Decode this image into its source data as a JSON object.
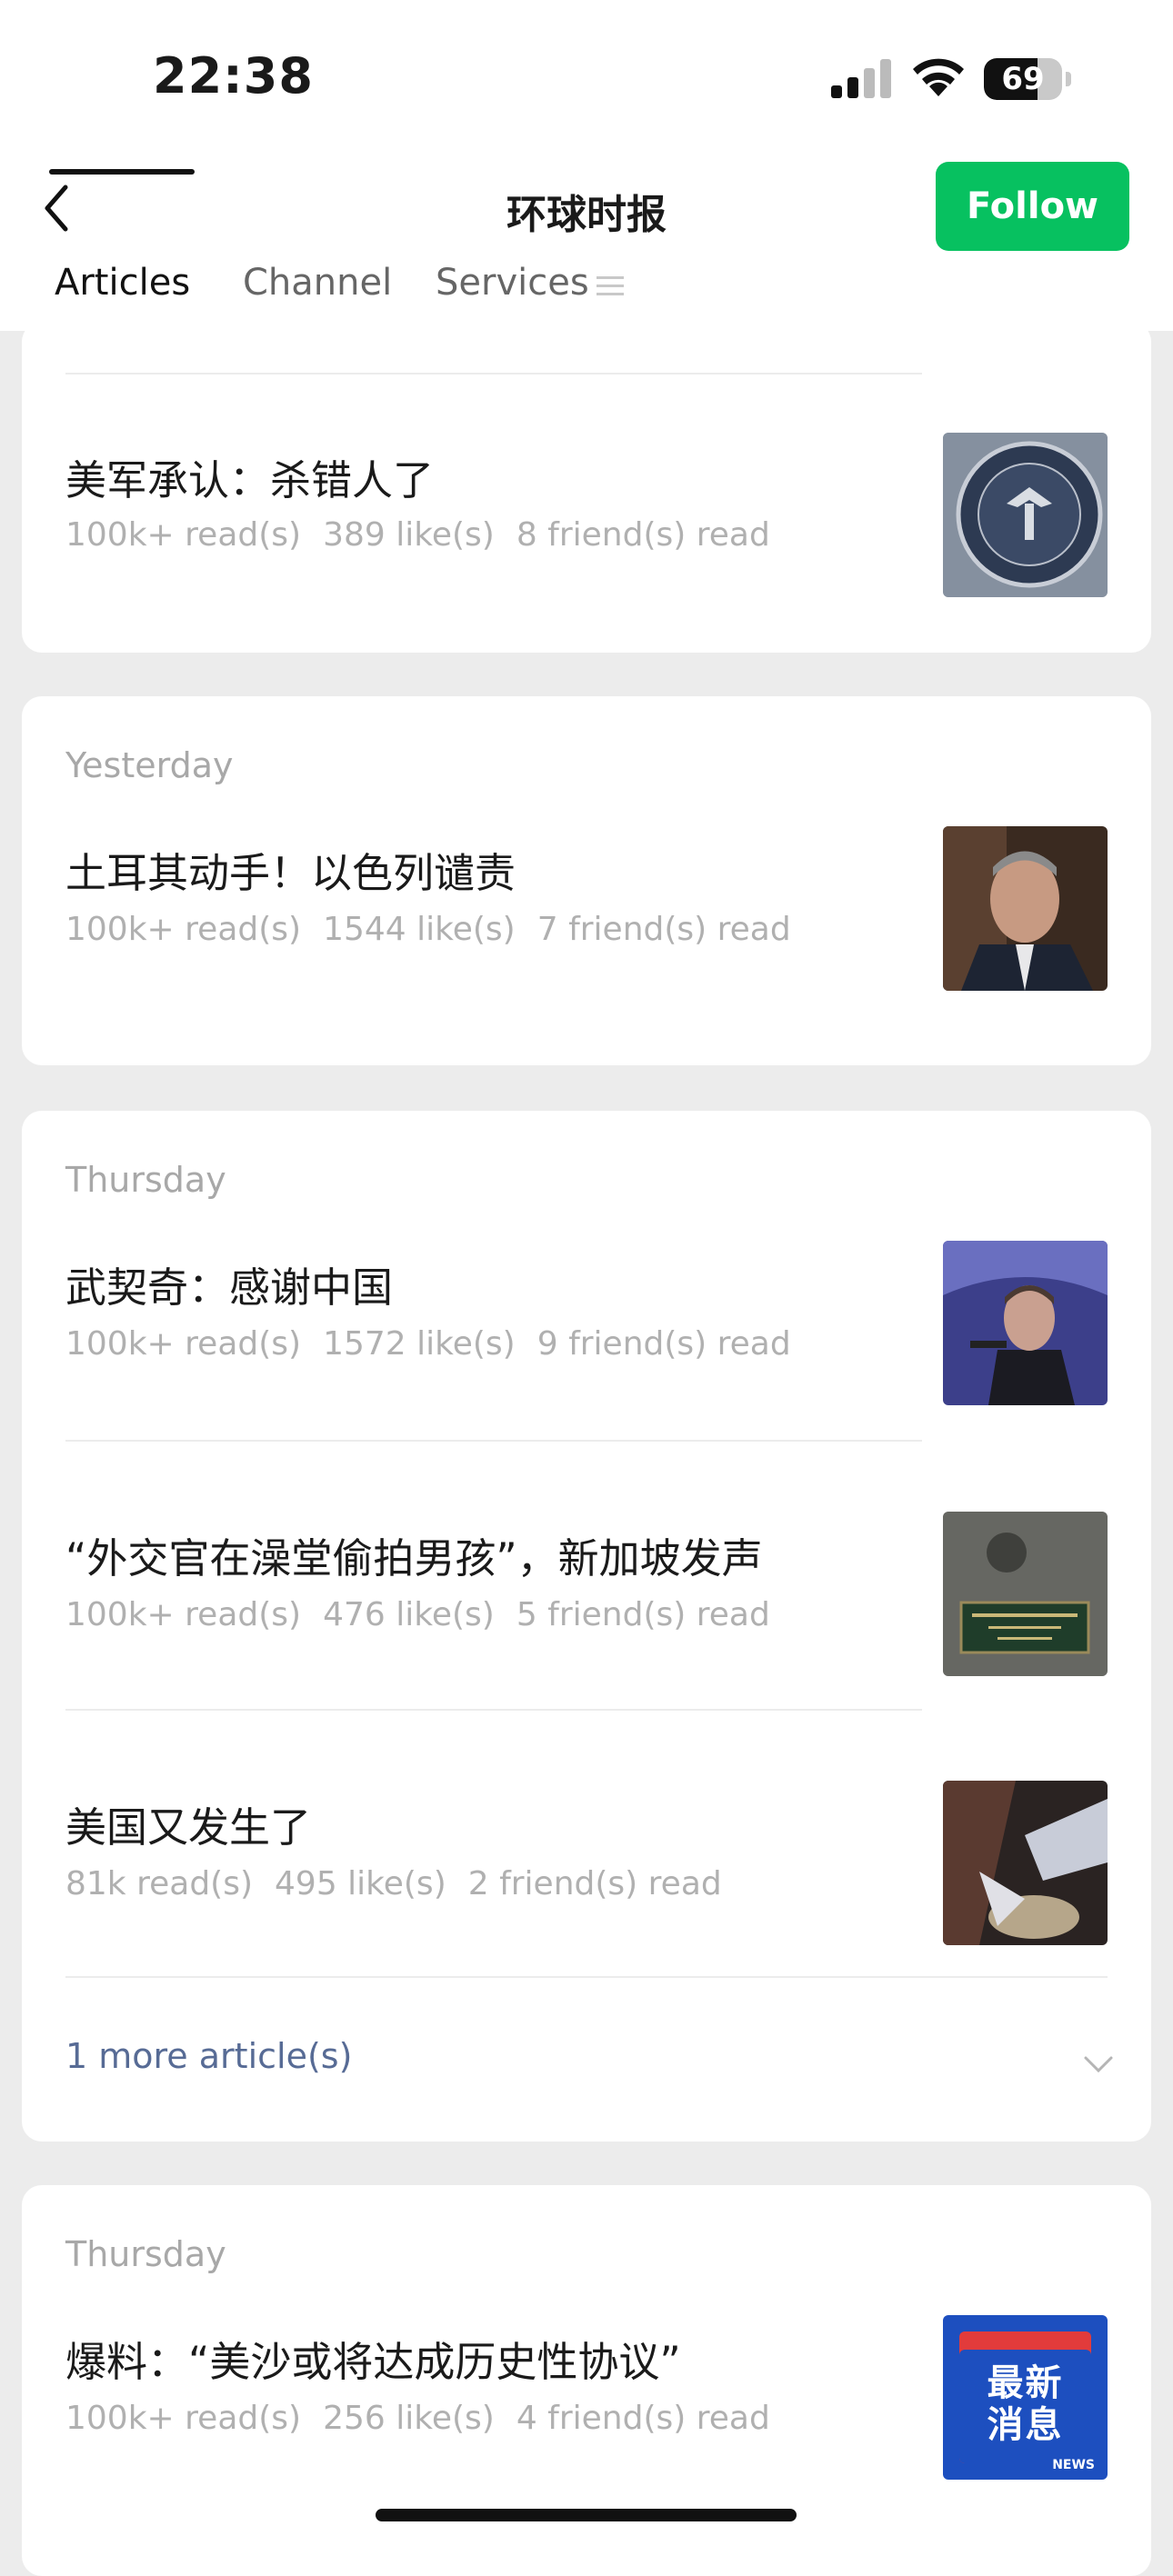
{
  "status": {
    "time": "22:38",
    "battery": "69",
    "battery_level": 0.69
  },
  "header": {
    "title": "环球时报",
    "follow_label": "Follow"
  },
  "tabs": [
    {
      "label": "Articles",
      "active": true
    },
    {
      "label": "Channel",
      "active": false
    },
    {
      "label": "Services",
      "active": false
    }
  ],
  "groups": [
    {
      "date": "",
      "articles": [
        {
          "title": "美军承认：杀错人了",
          "reads": "100k+ read(s)",
          "likes": "389 like(s)",
          "friends": "8 friend(s) read",
          "thumb": "central-command-seal"
        }
      ]
    },
    {
      "date": "Yesterday",
      "articles": [
        {
          "title": "土耳其动手！以色列谴责",
          "reads": "100k+ read(s)",
          "likes": "1544 like(s)",
          "friends": "7 friend(s) read",
          "thumb": "man-portrait"
        }
      ]
    },
    {
      "date": "Thursday",
      "articles": [
        {
          "title": "武契奇：感谢中国",
          "reads": "100k+ read(s)",
          "likes": "1572 like(s)",
          "friends": "9 friend(s) read",
          "thumb": "speaker-podium"
        },
        {
          "title": "“外交官在澡堂偷拍男孩”，新加坡发声",
          "reads": "100k+ read(s)",
          "likes": "476 like(s)",
          "friends": "5 friend(s) read",
          "thumb": "embassy-plaque"
        },
        {
          "title": "美国又发生了",
          "reads": "81k read(s)",
          "likes": "495 like(s)",
          "friends": "2 friend(s) read",
          "thumb": "night-scene"
        }
      ],
      "more": "1 more article(s)"
    },
    {
      "date": "Thursday",
      "articles": [
        {
          "title": "爆料：“美沙或将达成历史性协议”",
          "reads": "100k+ read(s)",
          "likes": "256 like(s)",
          "friends": "4 friend(s) read",
          "thumb": "news-badge",
          "thumb_text": "最新消息",
          "thumb_subtext": "NEWS"
        }
      ]
    }
  ]
}
